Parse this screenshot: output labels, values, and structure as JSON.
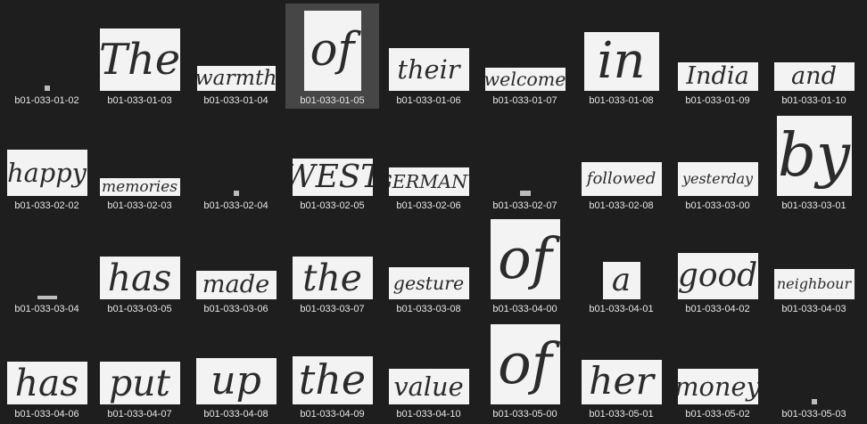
{
  "items": [
    {
      "label": "b01-033-01-02",
      "word": "",
      "selected": false
    },
    {
      "label": "b01-033-01-03",
      "word": "The",
      "selected": false
    },
    {
      "label": "b01-033-01-04",
      "word": "warmth",
      "selected": false
    },
    {
      "label": "b01-033-01-05",
      "word": "of",
      "selected": true
    },
    {
      "label": "b01-033-01-06",
      "word": "their",
      "selected": false
    },
    {
      "label": "b01-033-01-07",
      "word": "welcome",
      "selected": false
    },
    {
      "label": "b01-033-01-08",
      "word": "in",
      "selected": false
    },
    {
      "label": "b01-033-01-09",
      "word": "India",
      "selected": false
    },
    {
      "label": "b01-033-01-10",
      "word": "and",
      "selected": false
    },
    {
      "label": "b01-033-02-02",
      "word": "happy",
      "selected": false
    },
    {
      "label": "b01-033-02-03",
      "word": "memories",
      "selected": false
    },
    {
      "label": "b01-033-02-04",
      "word": "",
      "selected": false
    },
    {
      "label": "b01-033-02-05",
      "word": "WEST",
      "selected": false
    },
    {
      "label": "b01-033-02-06",
      "word": "GERMANY",
      "selected": false
    },
    {
      "label": "b01-033-02-07",
      "word": "",
      "selected": false
    },
    {
      "label": "b01-033-02-08",
      "word": "followed",
      "selected": false
    },
    {
      "label": "b01-033-03-00",
      "word": "yesterday",
      "selected": false
    },
    {
      "label": "b01-033-03-01",
      "word": "by",
      "selected": false
    },
    {
      "label": "b01-033-03-04",
      "word": "",
      "selected": false
    },
    {
      "label": "b01-033-03-05",
      "word": "has",
      "selected": false
    },
    {
      "label": "b01-033-03-06",
      "word": "made",
      "selected": false
    },
    {
      "label": "b01-033-03-07",
      "word": "the",
      "selected": false
    },
    {
      "label": "b01-033-03-08",
      "word": "gesture",
      "selected": false
    },
    {
      "label": "b01-033-04-00",
      "word": "of",
      "selected": false
    },
    {
      "label": "b01-033-04-01",
      "word": "a",
      "selected": false
    },
    {
      "label": "b01-033-04-02",
      "word": "good",
      "selected": false
    },
    {
      "label": "b01-033-04-03",
      "word": "neighbour",
      "selected": false
    },
    {
      "label": "b01-033-04-06",
      "word": "has",
      "selected": false
    },
    {
      "label": "b01-033-04-07",
      "word": "put",
      "selected": false
    },
    {
      "label": "b01-033-04-08",
      "word": "up",
      "selected": false
    },
    {
      "label": "b01-033-04-09",
      "word": "the",
      "selected": false
    },
    {
      "label": "b01-033-04-10",
      "word": "value",
      "selected": false
    },
    {
      "label": "b01-033-05-00",
      "word": "of",
      "selected": false
    },
    {
      "label": "b01-033-05-01",
      "word": "her",
      "selected": false
    },
    {
      "label": "b01-033-05-02",
      "word": "money",
      "selected": false
    },
    {
      "label": "b01-033-05-03",
      "word": "",
      "selected": false
    }
  ],
  "colors": {
    "background": "#1e1e1e",
    "selected": "#464646",
    "label": "#e6e6e6",
    "thumb": "#f3f3f3"
  }
}
